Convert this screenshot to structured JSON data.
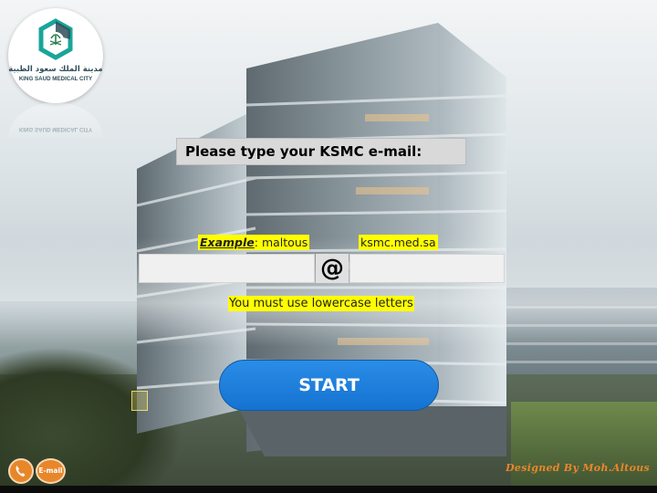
{
  "logo": {
    "arabic_text": "مدينة الملك سعود الطبية",
    "english_text": "KING SAUD MEDICAL CITY",
    "brand_colors": [
      "#2f4e5a",
      "#1aa59a"
    ]
  },
  "form": {
    "prompt": "Please type your KSMC e-mail:",
    "example_label": "Example",
    "example_value": ": maltous",
    "at_symbol": "@",
    "domain_example": "ksmc.med.sa",
    "username_value": "",
    "domain_value": "",
    "note": "You must use lowercase letters",
    "highlight_color": "#ffff00"
  },
  "buttons": {
    "start_label": "START",
    "start_color": "#1a7ddb",
    "email_label": "E-mail",
    "accent_color": "#e8862a"
  },
  "footer": {
    "credit": "Designed By Moh.Altous"
  },
  "icons": [
    "phone-icon",
    "email-icon",
    "logo-emblem-icon"
  ]
}
